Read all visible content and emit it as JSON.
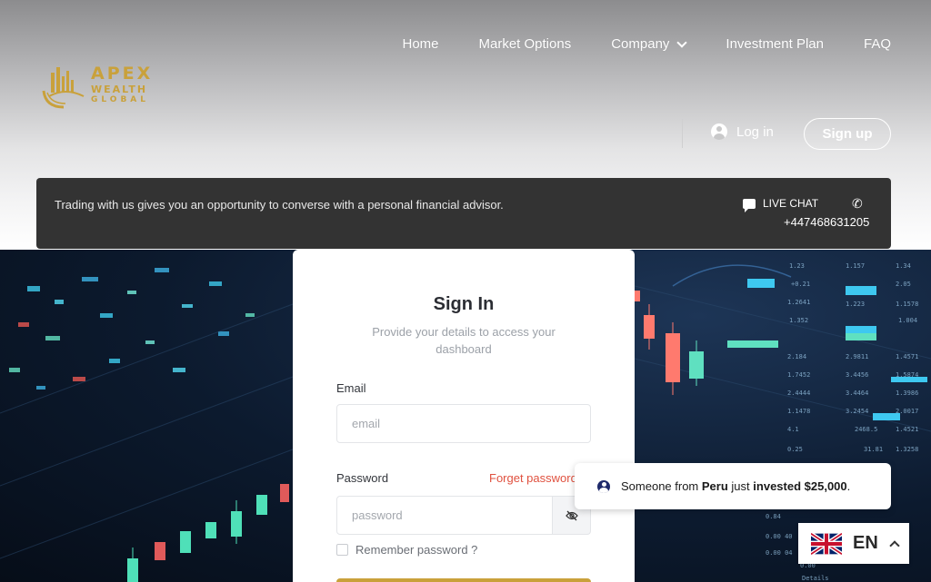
{
  "header": {
    "logo": {
      "line1": "APEX",
      "line2": "WEALTH",
      "line3": "GLOBAL",
      "color": "#c9a13b"
    },
    "nav": [
      {
        "label": "Home"
      },
      {
        "label": "Market Options"
      },
      {
        "label": "Company",
        "has_dropdown": true
      },
      {
        "label": "Investment Plan"
      },
      {
        "label": "FAQ"
      }
    ],
    "login_label": "Log in",
    "signup_label": "Sign up"
  },
  "infobar": {
    "message": "Trading with us gives you an opportunity to converse with a personal financial advisor.",
    "live_chat": "LIVE CHAT",
    "phone": "+447468631205"
  },
  "signin": {
    "title": "Sign In",
    "subtitle": "Provide your details to access your dashboard",
    "email_label": "Email",
    "email_placeholder": "email",
    "password_label": "Password",
    "forget_password": "Forget password",
    "password_placeholder": "password",
    "remember_label": "Remember password ?",
    "accent_color": "#c9a13b"
  },
  "toast": {
    "prefix": "Someone from",
    "country": "Peru",
    "middle": "just",
    "action": "invested $25,000",
    "suffix": "."
  },
  "language": {
    "code": "EN",
    "flag": "uk-flag"
  },
  "colors": {
    "forget_link": "#e0513f",
    "infobar_bg": "#333333"
  }
}
